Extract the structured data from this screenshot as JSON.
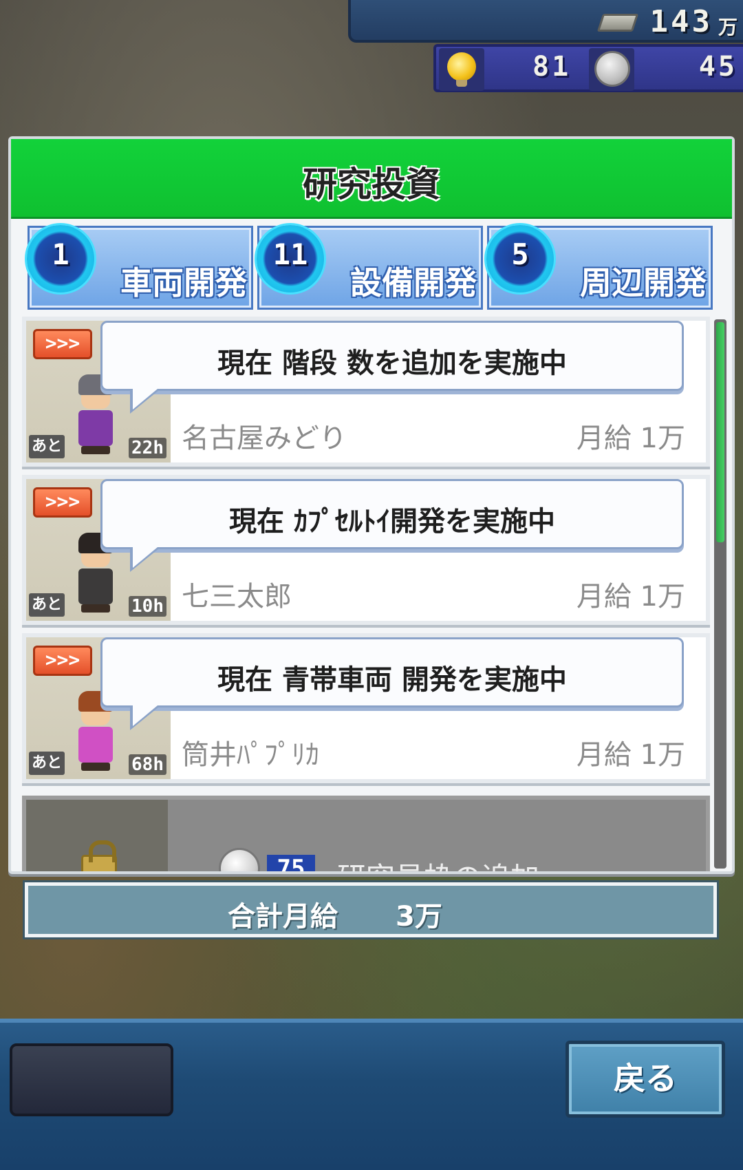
{
  "resources": {
    "money": "143",
    "money_unit": "万",
    "ideas": "81",
    "medals": "45",
    "icons": [
      "money-icon",
      "bulb-icon",
      "medal-icon"
    ]
  },
  "panel": {
    "title": "研究投資",
    "tabs": [
      {
        "count": "1",
        "label": "車両開発"
      },
      {
        "count": "11",
        "label": "設備開発"
      },
      {
        "count": "5",
        "label": "周辺開発"
      }
    ]
  },
  "staff": [
    {
      "status": "現在  階段  数を追加を実施中",
      "name": "名古屋みどり",
      "salary": "月給    1万",
      "remaining_label": "あと",
      "hours": "22h",
      "speed_icon": ">>>",
      "hair_color": "#6e6e76",
      "outfit_color": "#7e3aa6"
    },
    {
      "status": "現在  ｶﾌﾟｾﾙﾄｲ開発を実施中",
      "name": "七三太郎",
      "salary": "月給    1万",
      "remaining_label": "あと",
      "hours": "10h",
      "speed_icon": ">>>",
      "hair_color": "#2a2422",
      "outfit_color": "#3c3a3a"
    },
    {
      "status": "現在  青帯車両  開発を実施中",
      "name": "筒井ﾊﾟﾌﾟﾘｶ",
      "salary": "月給    1万",
      "remaining_label": "あと",
      "hours": "68h",
      "speed_icon": ">>>",
      "hair_color": "#9a4a22",
      "outfit_color": "#d050c4"
    }
  ],
  "add_slot": {
    "cost": "75",
    "label": "研究員枠の追加"
  },
  "total": {
    "label": "合計月給",
    "value": "3万"
  },
  "buttons": {
    "back": "戻る"
  },
  "colors": {
    "header_green": "#12d23a",
    "tab_blue": "#6ea4e6",
    "total_bar": "#6f96a6",
    "bottom_bar": "#1e4a74"
  }
}
